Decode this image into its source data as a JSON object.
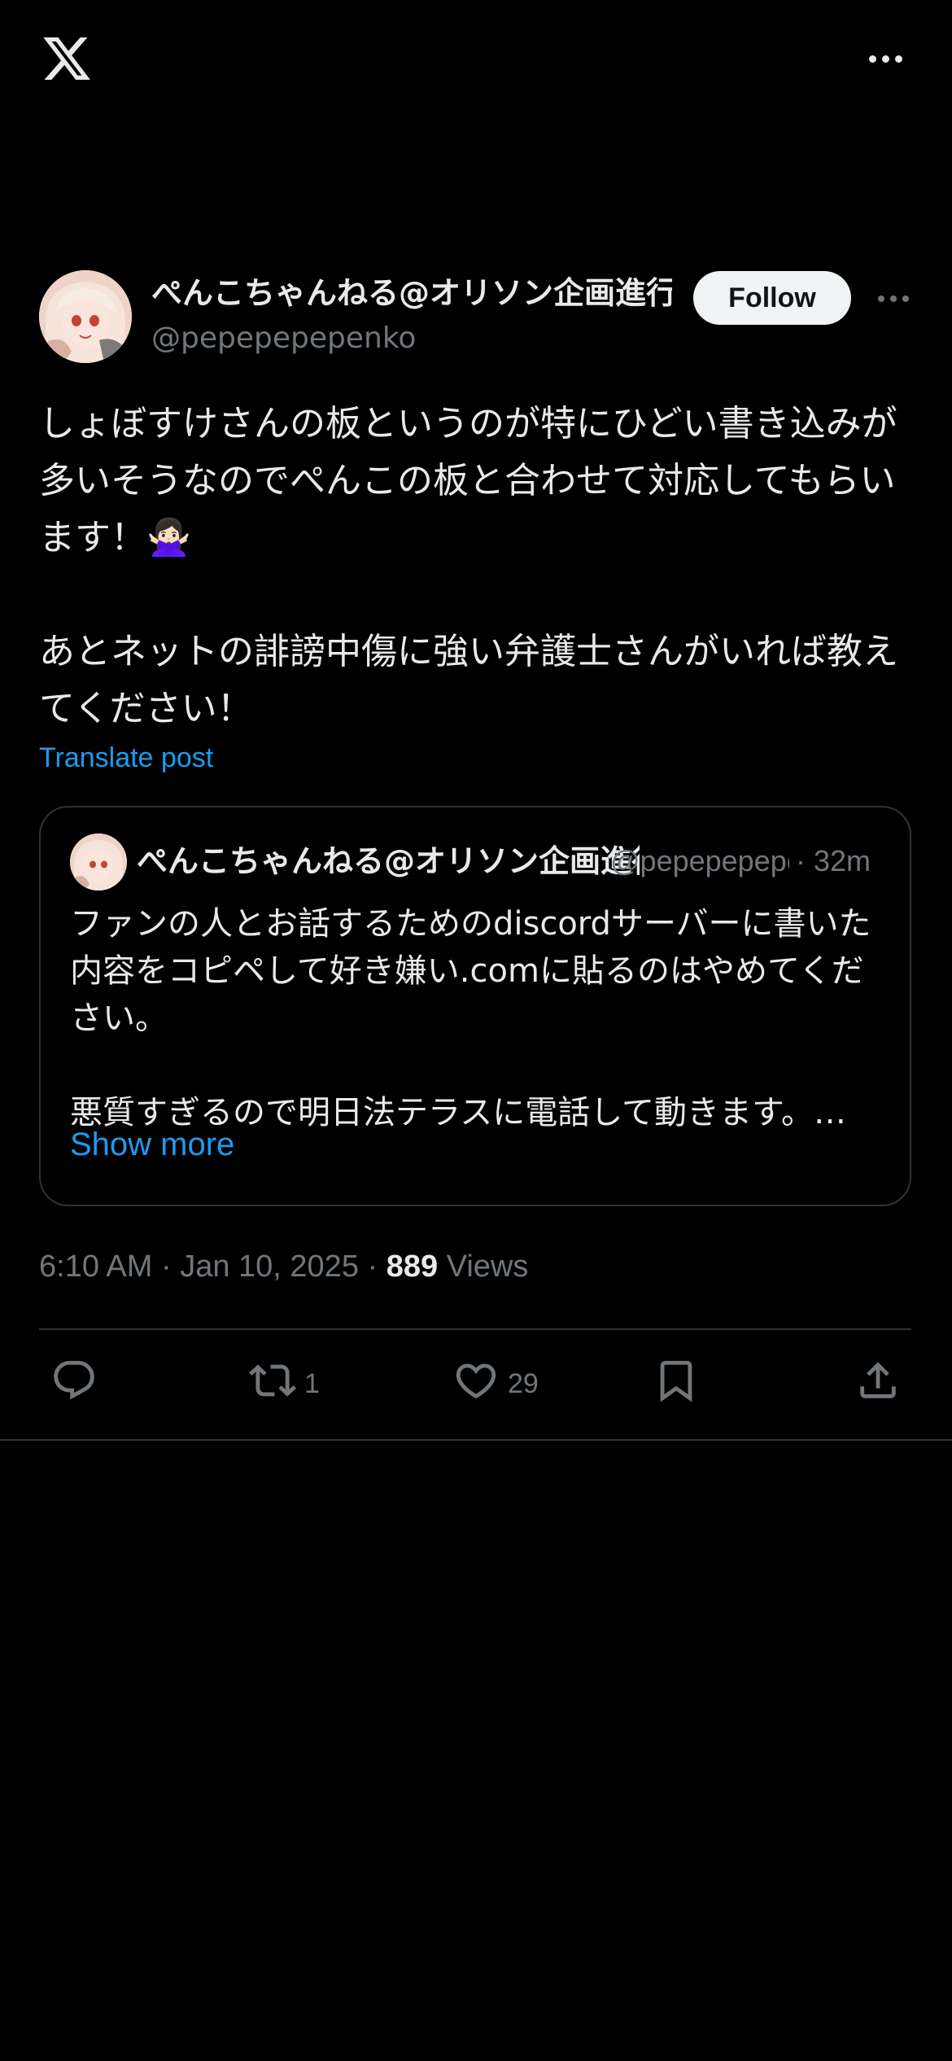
{
  "topbar": {
    "logo_icon": "x-logo-icon",
    "more_icon": "more-horizontal-icon"
  },
  "post": {
    "author": {
      "name": "ぺんこちゃんねる@オリソン企画進行中",
      "handle": "@pepepepepenko",
      "avatar_icon": "avatar"
    },
    "follow_label": "Follow",
    "text": "しょぼすけさんの板というのが特にひどい書き込みが多いそうなのでぺんこの板と合わせて対応してもらいます！🙅🏻‍♀️\n\nあとネットの誹謗中傷に強い弁護士さんがいれば教えてください！",
    "translate_label": "Translate post",
    "time": "6:10 AM",
    "date": "Jan 10, 2025",
    "views_count": "889",
    "views_label": "Views"
  },
  "quote": {
    "author_name": "ぺんこちゃんねる@オリソン企画進行中",
    "handle": "@pepepepepenko",
    "separator": "·",
    "time": "32m",
    "text": "ファンの人とお話するためのdiscordサーバーに書いた内容をコピペして好き嫌い.comに貼るのはやめてください。\n\n悪質すぎるので明日法テラスに電話して動きます。…",
    "show_more_label": "Show more"
  },
  "actions": {
    "reply_count": "",
    "repost_count": "1",
    "like_count": "29"
  },
  "colors": {
    "background": "#000000",
    "text": "#e7e9ea",
    "secondary": "#71767b",
    "accent": "#1d9bf0",
    "border": "#2f3336"
  }
}
